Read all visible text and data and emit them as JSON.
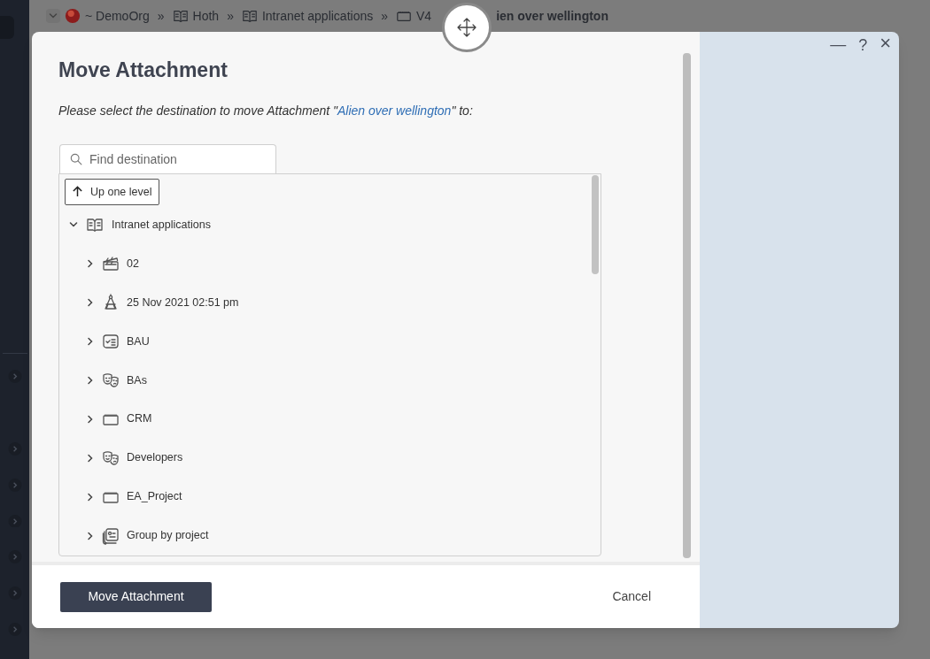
{
  "sidebar": {
    "items": [
      {
        "expanded": false
      },
      {
        "expanded": false
      },
      {
        "expanded": false
      },
      {
        "expanded": false
      },
      {
        "expanded": false
      },
      {
        "expanded": false
      },
      {
        "expanded": false
      }
    ]
  },
  "breadcrumb": {
    "items": [
      {
        "label": "~ DemoOrg",
        "kind": "org"
      },
      {
        "label": "Hoth",
        "kind": "book"
      },
      {
        "label": "Intranet applications",
        "kind": "book"
      },
      {
        "label": "V4",
        "kind": "board"
      }
    ],
    "separator": "»",
    "title_fragment": "ien over wellington"
  },
  "dialog": {
    "title": "Move Attachment",
    "prompt": "Please select the destination to move Attachment \"",
    "prompt_link": "Alien over wellington",
    "prompt_end": "\" to:",
    "search": {
      "placeholder": "Find destination"
    },
    "up_button": "Up one level",
    "tree": {
      "label": "Intranet applications",
      "kind": "book",
      "expanded": true,
      "children": [
        {
          "label": "02",
          "kind": "clapper",
          "expanded": false
        },
        {
          "label": "25 Nov 2021 02:51 pm",
          "kind": "compass",
          "expanded": false
        },
        {
          "label": "BAU",
          "kind": "checklist",
          "expanded": false
        },
        {
          "label": "BAs",
          "kind": "masks",
          "expanded": false
        },
        {
          "label": "CRM",
          "kind": "board",
          "expanded": false
        },
        {
          "label": "Developers",
          "kind": "masks",
          "expanded": false
        },
        {
          "label": "EA_Project",
          "kind": "board",
          "expanded": false
        },
        {
          "label": "Group by project",
          "kind": "group",
          "expanded": false
        }
      ]
    },
    "primary_button": "Move Attachment",
    "cancel_button": "Cancel",
    "window_controls": {
      "minimize": "—",
      "help": "?",
      "close": "×"
    }
  }
}
